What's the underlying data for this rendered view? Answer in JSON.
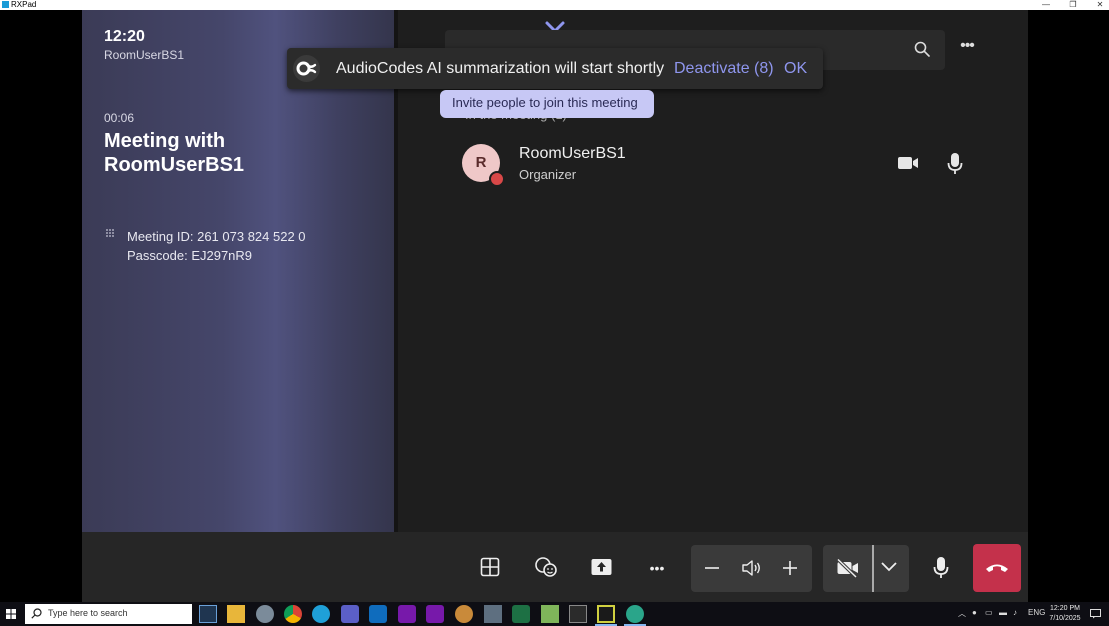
{
  "window": {
    "title": "RXPad",
    "minimize_glyph": "—",
    "restore_glyph": "❐",
    "close_glyph": "✕"
  },
  "left_panel": {
    "time": "12:20",
    "room_name": "RoomUserBS1",
    "duration": "00:06",
    "meeting_title": "Meeting with RoomUserBS1",
    "meeting_id": "Meeting ID:  261 073 824 522 0",
    "passcode": "Passcode: EJ297nR9"
  },
  "toast": {
    "message": "AudioCodes AI summarization will start shortly",
    "deactivate_label": "Deactivate (8)",
    "ok_label": "OK",
    "logo_icon": "audiocodes-logo"
  },
  "participants": {
    "header": "In the meeting (1)",
    "invite_tip": "Invite people to join this meeting",
    "items": [
      {
        "initial": "R",
        "name": "RoomUserBS1",
        "role": "Organizer"
      }
    ]
  },
  "taskbar": {
    "search_placeholder": "Type here to search",
    "tray_lang": "ENG",
    "time": "12:20 PM",
    "date": "7/10/2025"
  },
  "colors": {
    "accent": "#8f96ee",
    "hangup": "#c4314b",
    "invite_tip_bg": "#c7c8f5",
    "avatar_bg": "#efc8c8"
  }
}
